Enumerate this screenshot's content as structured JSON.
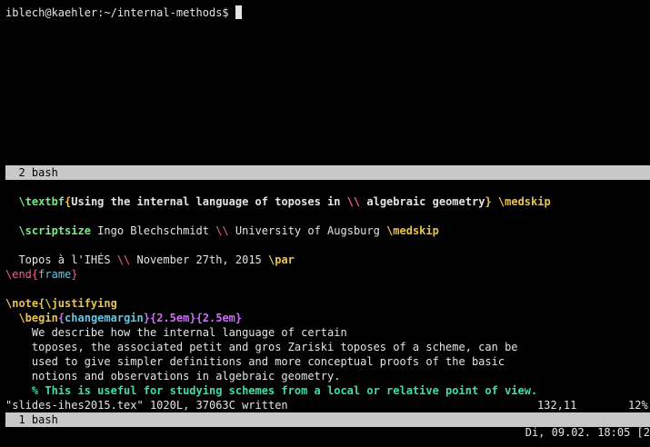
{
  "top_pane": {
    "prompt": "iblech@kaehler:~/internal-methods$ "
  },
  "pane_bar_top": {
    "label": "  2 bash"
  },
  "editor": {
    "l1": {
      "cmd": "\\textbf",
      "lb": "{",
      "text": "Using the internal language of toposes in ",
      "sep": "\\\\",
      "text2": " algebraic geometry",
      "rb": "}",
      "cmd2": "\\medskip"
    },
    "l2": {
      "cmd": "\\scriptsize",
      "text": " Ingo Blechschmidt ",
      "sep": "\\\\",
      "text2": " University of Augsburg ",
      "cmd2": "\\medskip"
    },
    "l3": {
      "text": "  Topos à l'IHÉS ",
      "sep": "\\\\",
      "text2": " November 27th, 2015 ",
      "cmd2": "\\par"
    },
    "l4": {
      "cmd": "\\end",
      "lb": "{",
      "arg": "frame",
      "rb": "}"
    },
    "l5": {
      "cmd": "\\note",
      "lb": "{",
      "cmd2": "\\justifying"
    },
    "l6": {
      "cmd": "\\begin",
      "lb": "{",
      "arg": "changemargin",
      "rb": "}",
      "arg2": "{2.5em}",
      "arg3": "{2.5em}"
    },
    "l7": "    We describe how the internal language of certain",
    "l8": "    toposes, the associated petit and gros Zariski toposes of a scheme, can be",
    "l9": "    used to give simpler definitions and more conceptual proofs of the basic",
    "l10": "    notions and observations in algebraic geometry.",
    "l11": "    % This is useful for studying schemes from a local or relative point of view."
  },
  "vim_status": {
    "message": "\"slides-ihes2015.tex\" 1020L, 37063C written",
    "position": "132,11",
    "percent": "12%"
  },
  "pane_bar_bottom": {
    "label": "  1 bash"
  },
  "tmux_status": {
    "clock": "Di, 09.02. 18:05 [2"
  }
}
